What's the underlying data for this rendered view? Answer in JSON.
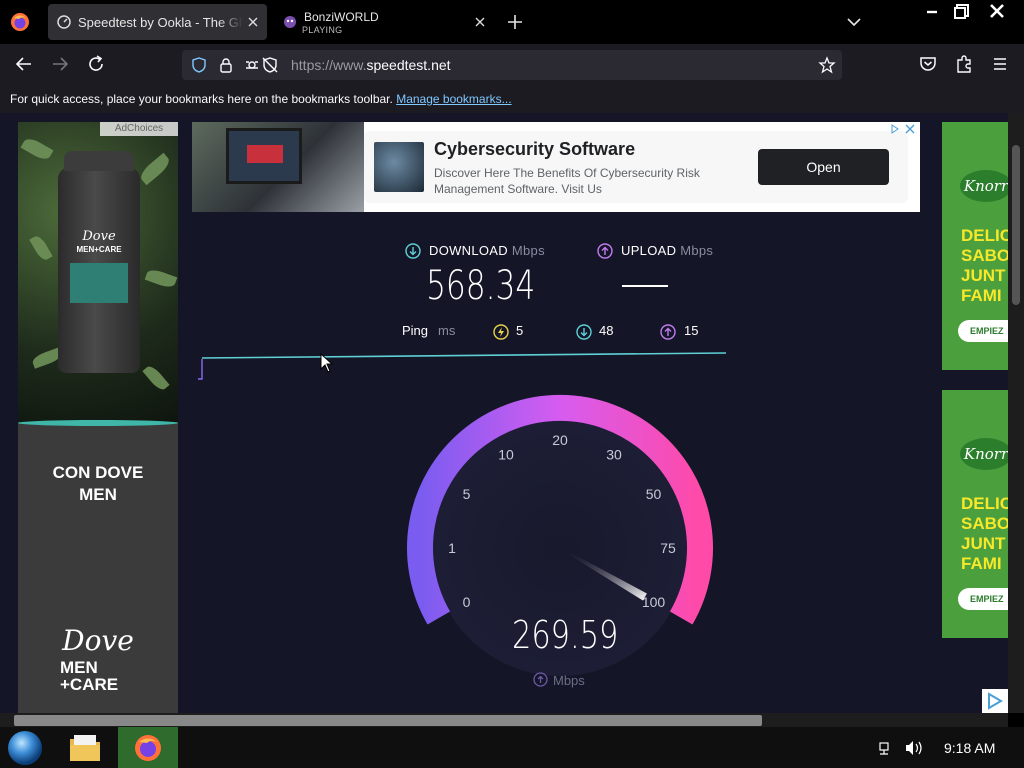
{
  "browser": {
    "tabs": [
      {
        "title": "Speedtest by Ookla - The Global Broadband Speed Test",
        "active": true
      },
      {
        "title": "BonziWORLD",
        "subtitle": "PLAYING",
        "active": false
      }
    ],
    "new_tab_icon": "plus-icon",
    "url_prefix": "https://www.",
    "url_domain": "speedtest.net",
    "bookmarks_message": "For quick access, place your bookmarks here on the bookmarks toolbar.",
    "bookmarks_link": "Manage bookmarks..."
  },
  "ads": {
    "left": {
      "adchoices": "AdChoices",
      "headline": "CON DOVE MEN",
      "brand": "Dove",
      "brand_sub": "MEN +CARE",
      "bottle_brand": "Dove",
      "bottle_sub": "MEN+CARE"
    },
    "top": {
      "headline": "Cybersecurity Software",
      "description": "Discover Here The Benefits Of Cybersecurity Risk Management Software. Visit Us",
      "cta": "Open"
    },
    "right": {
      "brand": "Knorr",
      "words": [
        "DELIC",
        "SABO",
        "JUNT",
        "FAMI"
      ],
      "cta": "EMPIEZ"
    }
  },
  "speedtest": {
    "download": {
      "label": "DOWNLOAD",
      "unit": "Mbps",
      "value": "568.34"
    },
    "upload": {
      "label": "UPLOAD",
      "unit": "Mbps",
      "value": "—"
    },
    "ping": {
      "label": "Ping",
      "unit": "ms",
      "idle": "5",
      "down": "48",
      "up": "15"
    },
    "gauge": {
      "ticks": [
        "0",
        "1",
        "5",
        "10",
        "20",
        "30",
        "50",
        "75",
        "100"
      ],
      "current_value": "269.59",
      "unit": "Mbps"
    }
  },
  "taskbar": {
    "clock": "9:18 AM"
  },
  "colors": {
    "page_bg": "#141526",
    "download_accent": "#5fd0d6",
    "upload_accent": "#c07cf0",
    "ping_idle": "#e8d34a",
    "gauge_start": "#7a5cf0",
    "gauge_end": "#ff4aa8"
  }
}
